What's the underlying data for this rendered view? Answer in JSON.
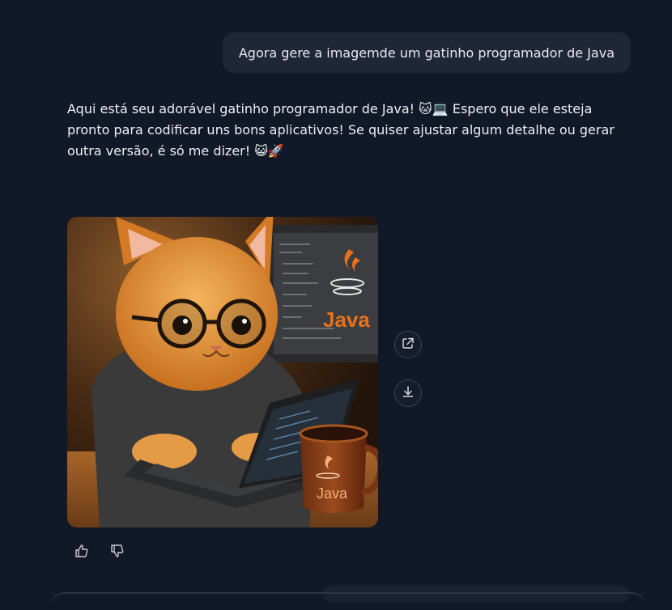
{
  "conversation": {
    "user_message": "Agora gere a imagemde um gatinho programador de Java",
    "assistant_message": "Aqui está seu adorável gatinho programador de Java! 🐱💻 Espero que ele esteja pronto para codificar uns bons aplicativos! Se quiser ajustar algum detalhe ou gerar outra versão, é só me dizer! 😺🚀"
  },
  "generated_image": {
    "screen_logo_text": "Java",
    "mug_logo_text": "Java"
  },
  "actions": {
    "share_icon": "share-icon",
    "download_icon": "download-icon",
    "like_icon": "thumbs-up-icon",
    "dislike_icon": "thumbs-down-icon"
  },
  "colors": {
    "background": "#111827",
    "user_bubble": "#1f2638",
    "java_orange": "#e8721c"
  }
}
